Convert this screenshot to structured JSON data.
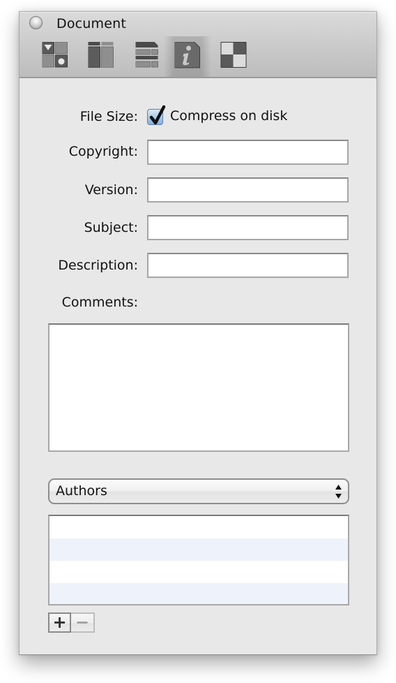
{
  "window": {
    "title": "Document"
  },
  "toolbar": {
    "tabs": [
      {
        "icon": "metadata-widgets-icon",
        "label": "Widgets",
        "selected": false
      },
      {
        "icon": "layout-columns-icon",
        "label": "Layout",
        "selected": false
      },
      {
        "icon": "table-rows-icon",
        "label": "Table",
        "selected": false
      },
      {
        "icon": "info-icon",
        "label": "Info",
        "selected": true
      },
      {
        "icon": "checker-icon",
        "label": "Appearance",
        "selected": false
      }
    ]
  },
  "form": {
    "file_size_label": "File Size:",
    "compress_label": "Compress on disk",
    "compress_checked": true,
    "copyright_label": "Copyright:",
    "copyright_value": "",
    "version_label": "Version:",
    "version_value": "",
    "subject_label": "Subject:",
    "subject_value": "",
    "description_label": "Description:",
    "description_value": "",
    "comments_label": "Comments:",
    "comments_value": ""
  },
  "people": {
    "selected": "Authors",
    "rows": [
      "",
      "",
      "",
      ""
    ],
    "add_label": "+",
    "remove_label": "−"
  },
  "colors": {
    "checkbox_accent": "#86b1e0",
    "list_alt_row": "#eef2fa",
    "window_bg": "#e8e8e8"
  }
}
